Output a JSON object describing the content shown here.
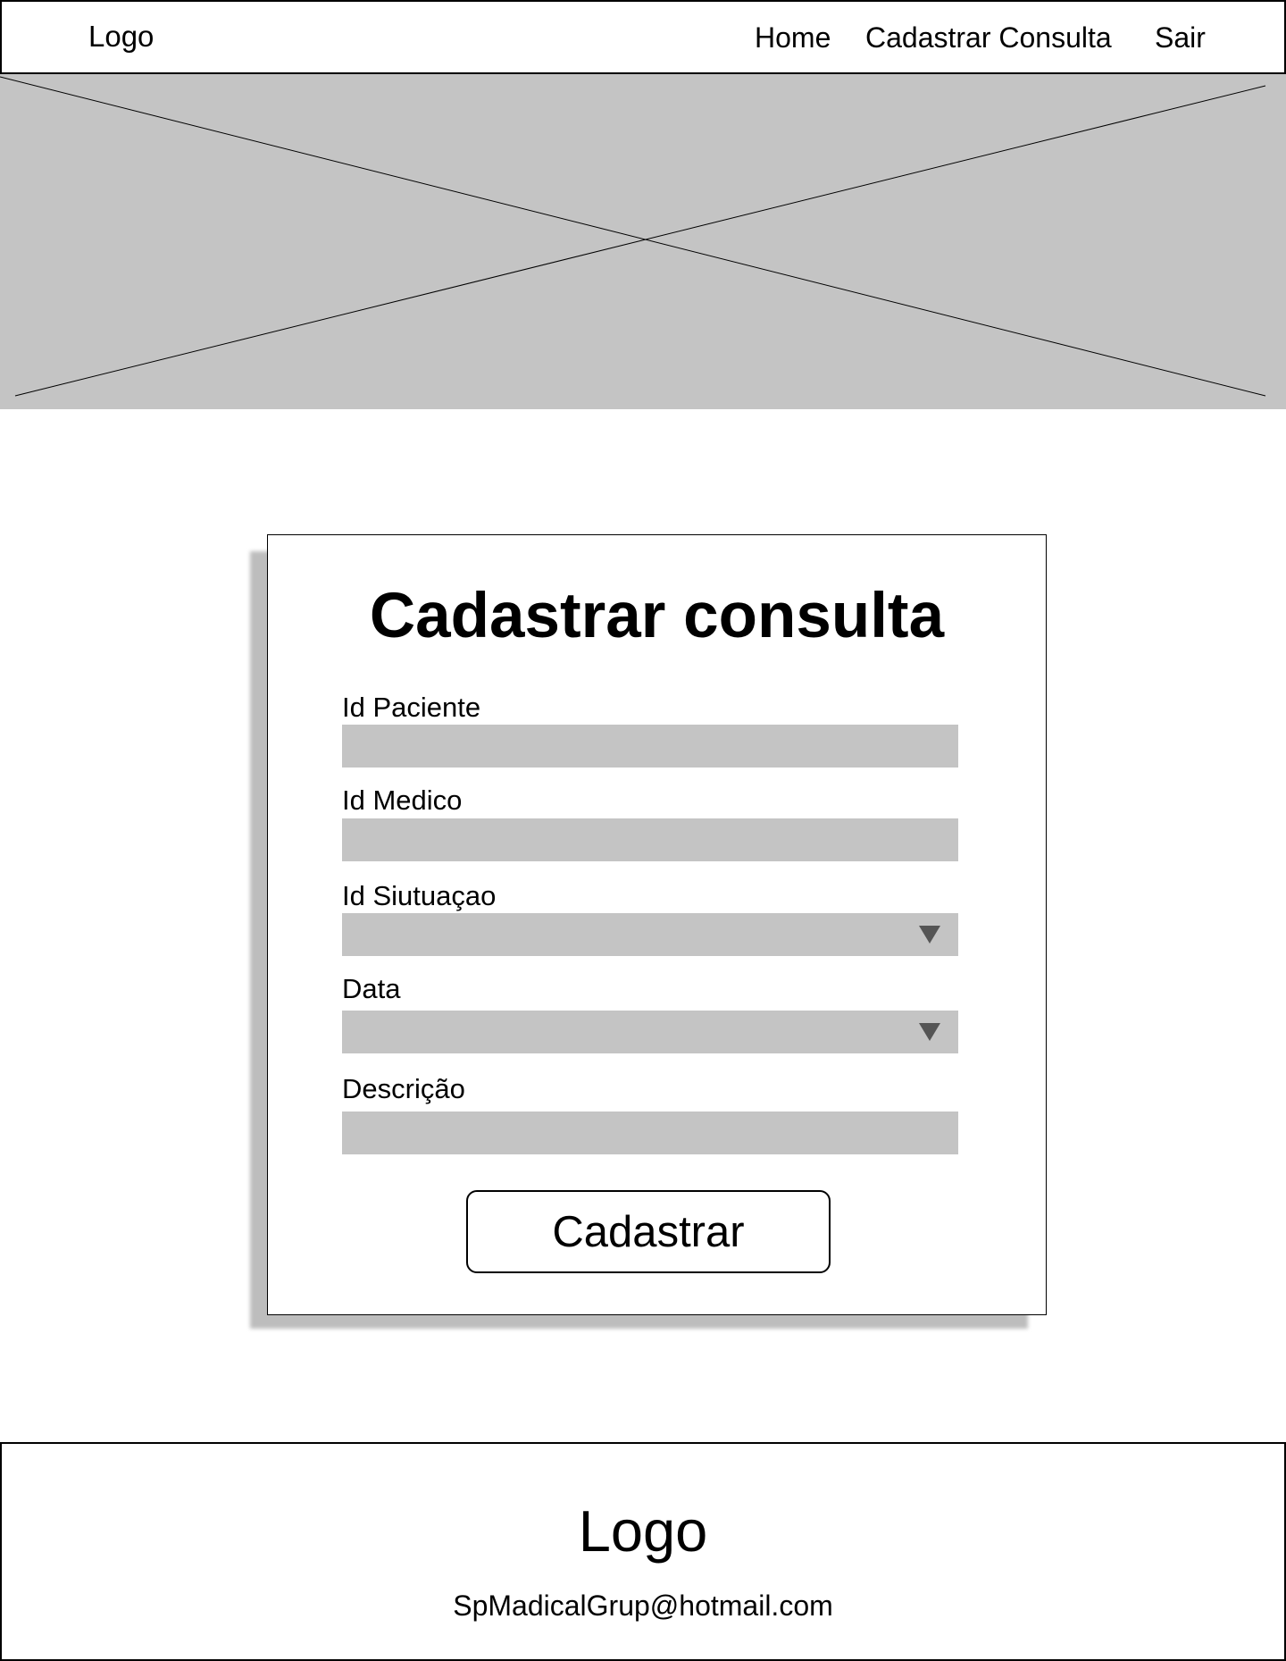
{
  "header": {
    "logo": "Logo",
    "nav": {
      "home": "Home",
      "cadastrar_consulta": "Cadastrar Consulta",
      "sair": "Sair"
    }
  },
  "hero": {
    "placeholder_icon": "image-placeholder-icon"
  },
  "form": {
    "title": "Cadastrar consulta",
    "fields": {
      "id_paciente": {
        "label": "Id Paciente",
        "value": ""
      },
      "id_medico": {
        "label": "Id Medico",
        "value": ""
      },
      "id_situacao": {
        "label": "Id Siutuaçao",
        "value": ""
      },
      "data": {
        "label": "Data",
        "value": ""
      },
      "descricao": {
        "label": "Descrição",
        "value": ""
      }
    },
    "submit_label": "Cadastrar"
  },
  "footer": {
    "logo": "Logo",
    "email": "SpMadicalGrup@hotmail.com"
  },
  "colors": {
    "placeholder_gray": "#c4c4c4",
    "shadow_gray": "#bdbdbd",
    "caret_gray": "#555555",
    "border": "#000000"
  }
}
